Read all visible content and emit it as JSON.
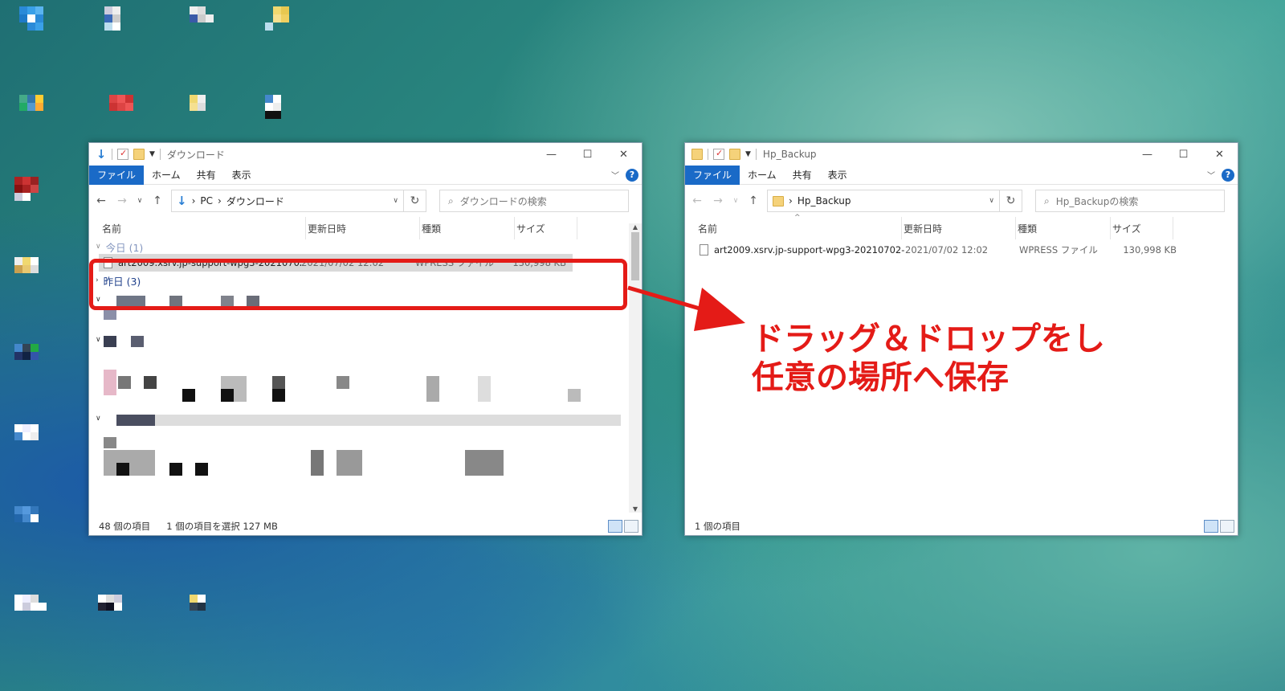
{
  "left_window": {
    "title": "ダウンロード",
    "ribbon": {
      "file": "ファイル",
      "home": "ホーム",
      "share": "共有",
      "view": "表示"
    },
    "address": {
      "pc": "PC",
      "folder": "ダウンロード"
    },
    "search_placeholder": "ダウンロードの検索",
    "columns": {
      "name": "名前",
      "date": "更新日時",
      "type": "種類",
      "size": "サイズ"
    },
    "group_today": "今日 (1)",
    "group_yesterday": "昨日 (3)",
    "selected_file": {
      "name": "art2009.xsrv.jp-support-wpg3-20210702-...",
      "date": "2021/07/02 12:02",
      "type": "WPRESS ファイル",
      "size": "130,998 KB"
    },
    "status": {
      "count": "48 個の項目",
      "selection": "1 個の項目を選択  127 MB"
    }
  },
  "right_window": {
    "title": "Hp_Backup",
    "ribbon": {
      "file": "ファイル",
      "home": "ホーム",
      "share": "共有",
      "view": "表示"
    },
    "address": {
      "folder": "Hp_Backup"
    },
    "search_placeholder": "Hp_Backupの検索",
    "columns": {
      "name": "名前",
      "date": "更新日時",
      "type": "種類",
      "size": "サイズ"
    },
    "file": {
      "name": "art2009.xsrv.jp-support-wpg3-20210702-...",
      "date": "2021/07/02 12:02",
      "type": "WPRESS ファイル",
      "size": "130,998 KB"
    },
    "status": {
      "count": "1 個の項目"
    }
  },
  "annotation": {
    "line1": "ドラッグ＆ドロップをし",
    "line2": "任意の場所へ保存"
  },
  "colors": {
    "annotation_red": "#e41b17",
    "accent_blue": "#1a6ac7"
  }
}
